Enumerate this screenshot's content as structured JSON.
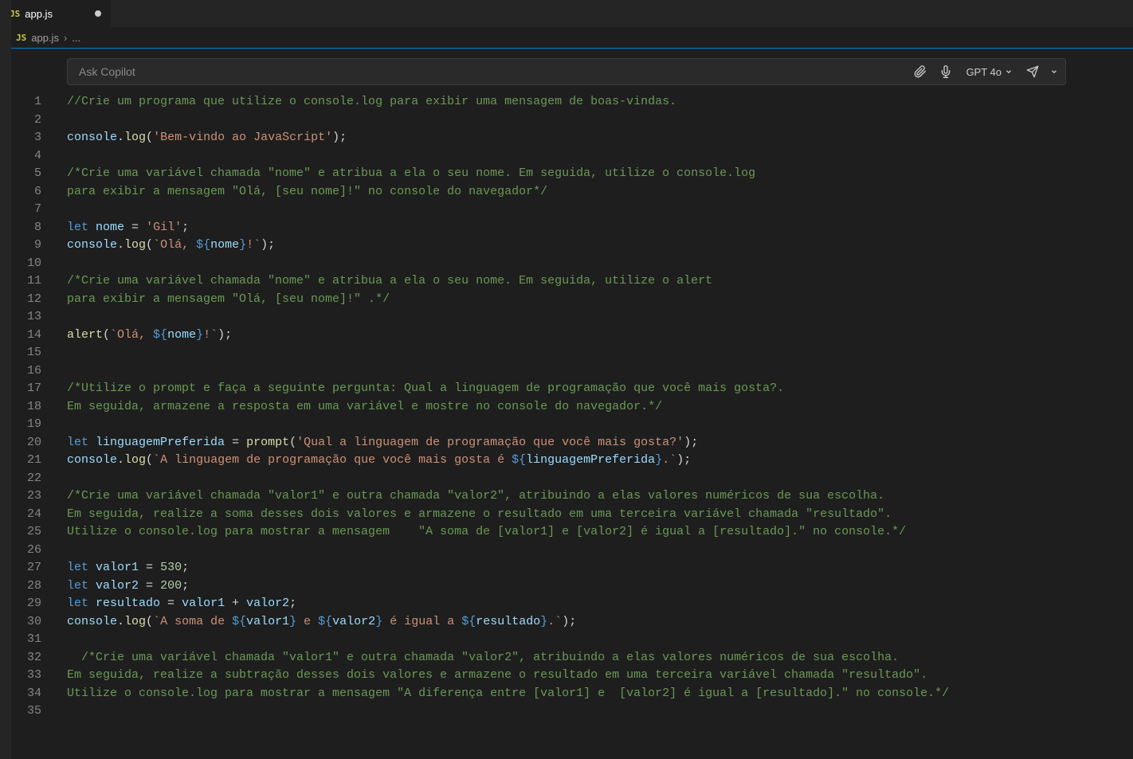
{
  "tab": {
    "badge": "JS",
    "title": "app.js"
  },
  "breadcrumb": {
    "badge": "JS",
    "file": "app.js",
    "sep": "›",
    "rest": "..."
  },
  "copilot": {
    "placeholder": "Ask Copilot",
    "model": "GPT 4o"
  },
  "lines": [
    [
      {
        "c": "c-comment",
        "t": "//Crie um programa que utilize o console.log para exibir uma mensagem de boas-vindas."
      }
    ],
    [],
    [
      {
        "c": "c-ident",
        "t": "console"
      },
      {
        "c": "c-punc",
        "t": "."
      },
      {
        "c": "c-call",
        "t": "log"
      },
      {
        "c": "c-punc",
        "t": "("
      },
      {
        "c": "c-string",
        "t": "'Bem-vindo ao JavaScript'"
      },
      {
        "c": "c-punc",
        "t": ");"
      }
    ],
    [],
    [
      {
        "c": "c-comment",
        "t": "/*Crie uma variável chamada \"nome\" e atribua a ela o seu nome. Em seguida, utilize o console.log"
      }
    ],
    [
      {
        "c": "c-comment",
        "t": "para exibir a mensagem \"Olá, [seu nome]!\" no console do navegador*/"
      }
    ],
    [],
    [
      {
        "c": "c-key",
        "t": "let"
      },
      {
        "c": "c-punc",
        "t": " "
      },
      {
        "c": "c-var",
        "t": "nome"
      },
      {
        "c": "c-punc",
        "t": " = "
      },
      {
        "c": "c-string",
        "t": "'Gil'"
      },
      {
        "c": "c-punc",
        "t": ";"
      }
    ],
    [
      {
        "c": "c-ident",
        "t": "console"
      },
      {
        "c": "c-punc",
        "t": "."
      },
      {
        "c": "c-call",
        "t": "log"
      },
      {
        "c": "c-punc",
        "t": "("
      },
      {
        "c": "c-string",
        "t": "`Olá, "
      },
      {
        "c": "c-tplbr",
        "t": "${"
      },
      {
        "c": "c-var",
        "t": "nome"
      },
      {
        "c": "c-tplbr",
        "t": "}"
      },
      {
        "c": "c-string",
        "t": "!`"
      },
      {
        "c": "c-punc",
        "t": ");"
      }
    ],
    [],
    [
      {
        "c": "c-comment",
        "t": "/*Crie uma variável chamada \"nome\" e atribua a ela o seu nome. Em seguida, utilize o alert"
      }
    ],
    [
      {
        "c": "c-comment",
        "t": "para exibir a mensagem \"Olá, [seu nome]!\" .*/"
      }
    ],
    [],
    [
      {
        "c": "c-call",
        "t": "alert"
      },
      {
        "c": "c-punc",
        "t": "("
      },
      {
        "c": "c-string",
        "t": "`Olá, "
      },
      {
        "c": "c-tplbr",
        "t": "${"
      },
      {
        "c": "c-var",
        "t": "nome"
      },
      {
        "c": "c-tplbr",
        "t": "}"
      },
      {
        "c": "c-string",
        "t": "!`"
      },
      {
        "c": "c-punc",
        "t": ");"
      }
    ],
    [],
    [],
    [
      {
        "c": "c-comment",
        "t": "/*Utilize o prompt e faça a seguinte pergunta: Qual a linguagem de programação que você mais gosta?."
      }
    ],
    [
      {
        "c": "c-comment",
        "t": "Em seguida, armazene a resposta em uma variável e mostre no console do navegador.*/"
      }
    ],
    [],
    [
      {
        "c": "c-key",
        "t": "let"
      },
      {
        "c": "c-punc",
        "t": " "
      },
      {
        "c": "c-var",
        "t": "linguagemPreferida"
      },
      {
        "c": "c-punc",
        "t": " = "
      },
      {
        "c": "c-call",
        "t": "prompt"
      },
      {
        "c": "c-punc",
        "t": "("
      },
      {
        "c": "c-string",
        "t": "'Qual a linguagem de programação que você mais gosta?'"
      },
      {
        "c": "c-punc",
        "t": ");"
      }
    ],
    [
      {
        "c": "c-ident",
        "t": "console"
      },
      {
        "c": "c-punc",
        "t": "."
      },
      {
        "c": "c-call",
        "t": "log"
      },
      {
        "c": "c-punc",
        "t": "("
      },
      {
        "c": "c-string",
        "t": "`A linguagem de programação que você mais gosta é "
      },
      {
        "c": "c-tplbr",
        "t": "${"
      },
      {
        "c": "c-var",
        "t": "linguagemPreferida"
      },
      {
        "c": "c-tplbr",
        "t": "}"
      },
      {
        "c": "c-string",
        "t": ".`"
      },
      {
        "c": "c-punc",
        "t": ");"
      }
    ],
    [],
    [
      {
        "c": "c-comment",
        "t": "/*Crie uma variável chamada \"valor1\" e outra chamada \"valor2\", atribuindo a elas valores numéricos de sua escolha."
      }
    ],
    [
      {
        "c": "c-comment",
        "t": "Em seguida, realize a soma desses dois valores e armazene o resultado em uma terceira variável chamada \"resultado\"."
      }
    ],
    [
      {
        "c": "c-comment",
        "t": "Utilize o console.log para mostrar a mensagem    \"A soma de [valor1] e [valor2] é igual a [resultado].\" no console.*/"
      }
    ],
    [],
    [
      {
        "c": "c-key",
        "t": "let"
      },
      {
        "c": "c-punc",
        "t": " "
      },
      {
        "c": "c-var",
        "t": "valor1"
      },
      {
        "c": "c-punc",
        "t": " = "
      },
      {
        "c": "c-num",
        "t": "530"
      },
      {
        "c": "c-punc",
        "t": ";"
      }
    ],
    [
      {
        "c": "c-key",
        "t": "let"
      },
      {
        "c": "c-punc",
        "t": " "
      },
      {
        "c": "c-var",
        "t": "valor2"
      },
      {
        "c": "c-punc",
        "t": " = "
      },
      {
        "c": "c-num",
        "t": "200"
      },
      {
        "c": "c-punc",
        "t": ";"
      }
    ],
    [
      {
        "c": "c-key",
        "t": "let"
      },
      {
        "c": "c-punc",
        "t": " "
      },
      {
        "c": "c-var",
        "t": "resultado"
      },
      {
        "c": "c-punc",
        "t": " = "
      },
      {
        "c": "c-var",
        "t": "valor1"
      },
      {
        "c": "c-punc",
        "t": " + "
      },
      {
        "c": "c-var",
        "t": "valor2"
      },
      {
        "c": "c-punc",
        "t": ";"
      }
    ],
    [
      {
        "c": "c-ident",
        "t": "console"
      },
      {
        "c": "c-punc",
        "t": "."
      },
      {
        "c": "c-call",
        "t": "log"
      },
      {
        "c": "c-punc",
        "t": "("
      },
      {
        "c": "c-string",
        "t": "`A soma de "
      },
      {
        "c": "c-tplbr",
        "t": "${"
      },
      {
        "c": "c-var",
        "t": "valor1"
      },
      {
        "c": "c-tplbr",
        "t": "}"
      },
      {
        "c": "c-string",
        "t": " e "
      },
      {
        "c": "c-tplbr",
        "t": "${"
      },
      {
        "c": "c-var",
        "t": "valor2"
      },
      {
        "c": "c-tplbr",
        "t": "}"
      },
      {
        "c": "c-string",
        "t": " é igual a "
      },
      {
        "c": "c-tplbr",
        "t": "${"
      },
      {
        "c": "c-var",
        "t": "resultado"
      },
      {
        "c": "c-tplbr",
        "t": "}"
      },
      {
        "c": "c-string",
        "t": ".`"
      },
      {
        "c": "c-punc",
        "t": ");"
      }
    ],
    [],
    [
      {
        "c": "c-comment",
        "t": "  /*Crie uma variável chamada \"valor1\" e outra chamada \"valor2\", atribuindo a elas valores numéricos de sua escolha."
      }
    ],
    [
      {
        "c": "c-comment",
        "t": "Em seguida, realize a subtração desses dois valores e armazene o resultado em uma terceira variável chamada \"resultado\"."
      }
    ],
    [
      {
        "c": "c-comment",
        "t": "Utilize o console.log para mostrar a mensagem \"A diferença entre [valor1] e  [valor2] é igual a [resultado].\" no console.*/"
      }
    ],
    []
  ]
}
